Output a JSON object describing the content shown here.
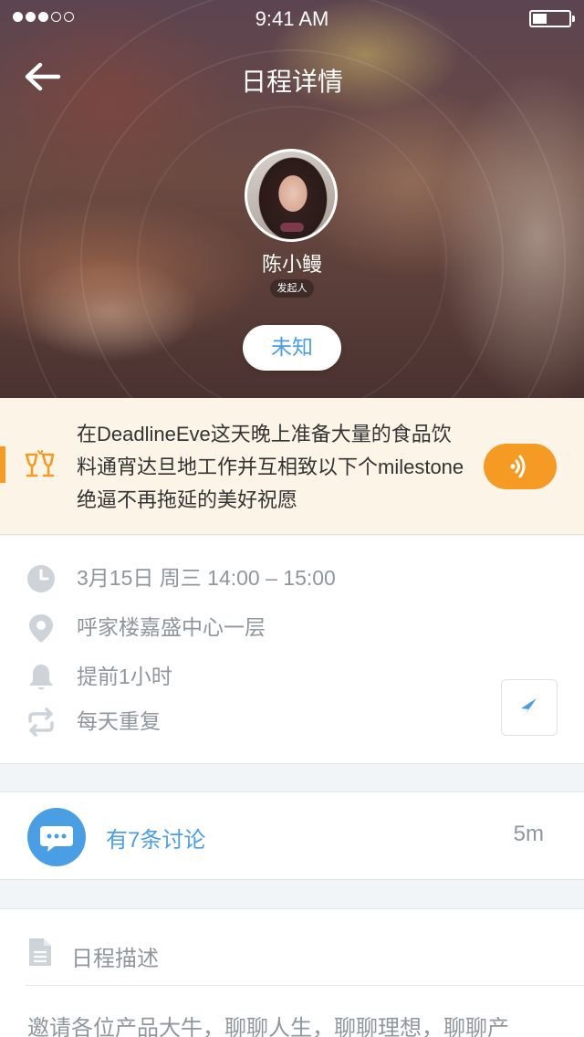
{
  "status_bar": {
    "time": "9:41 AM",
    "signal_filled": 3,
    "signal_total": 5,
    "battery_level": 0.4
  },
  "nav": {
    "title": "日程详情",
    "back_icon": "arrow-left-icon"
  },
  "organizer": {
    "name": "陈小鳗",
    "role": "发起人"
  },
  "status_pill": "未知",
  "banner": {
    "text": "在DeadlineEve这天晚上准备大量的食品饮料通宵达旦地工作并互相致以下个milestone绝逼不再拖延的美好祝愿",
    "icon": "cheers-icon",
    "voice_icon": "sound-wave-icon"
  },
  "info": {
    "time": "3月15日 周三 14:00 – 15:00",
    "location": "呼家楼嘉盛中心一层",
    "reminder": "提前1小时",
    "repeat": "每天重复"
  },
  "discussion": {
    "label": "有7条讨论",
    "time": "5m"
  },
  "description": {
    "title": "日程描述",
    "body": "邀请各位产品大牛，聊聊人生，聊聊理想，聊聊产"
  },
  "colors": {
    "accent_blue": "#4a9ee4",
    "accent_orange": "#f59a23",
    "banner_bg": "#fdf4e8",
    "muted_text": "#8f969c"
  }
}
